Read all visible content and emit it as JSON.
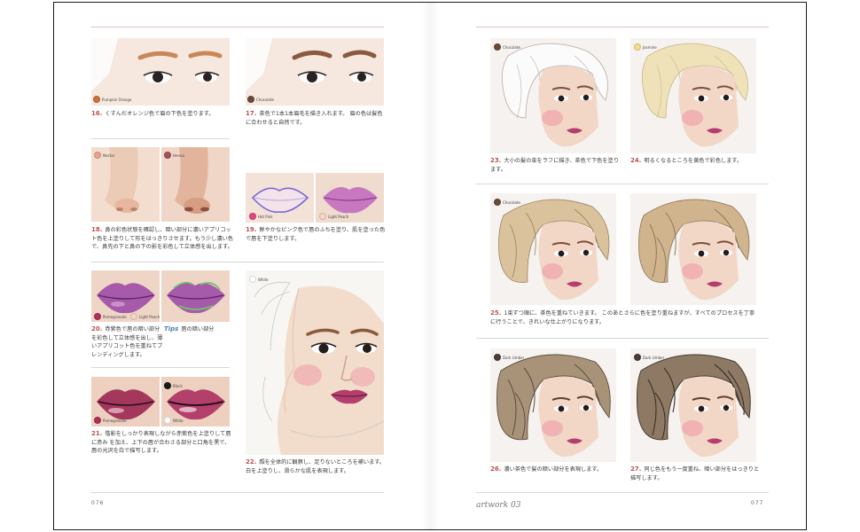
{
  "left_page": {
    "folio": "076",
    "steps": {
      "s16": {
        "num": "16.",
        "text": "くすんだオレンジ色で眉の下色を塗ります。",
        "swatches": [
          {
            "label": "Pumpkin Orange",
            "color": "#c8733a"
          }
        ]
      },
      "s17": {
        "num": "17.",
        "text": "茶色で1本1本眉毛を描き入れます。 眉の色は髪色に合わせると自然です。",
        "swatches": [
          {
            "label": "Chocolate",
            "color": "#6a4a3a"
          }
        ]
      },
      "s18": {
        "num": "18.",
        "text": "鼻の彩色状態を確認し、暗い部分に濃いアプリコット色を上塗りして形をはっきりさせます。もう少し濃い色で、鼻先の下と鼻の下の影を彩色して立体感を出します。",
        "swatches": [
          {
            "label": "Nectar",
            "color": "#e8a589"
          },
          {
            "label": "Henna",
            "color": "#a6505a"
          }
        ]
      },
      "s19": {
        "num": "19.",
        "text": "鮮やかなピンク色で唇のふちを塗り、肌を塗った色で唇を下塗りします。",
        "swatches": [
          {
            "label": "Hot Pink",
            "color": "#e0457f"
          },
          {
            "label": "Light Peach",
            "color": "#f4d6c4"
          }
        ]
      },
      "s20": {
        "num": "20.",
        "text": "赤紫色で唇の暗い部分を彩色して立体感を出し、薄いアプリコット色を重ねてブレンディングします。",
        "swatches": [
          {
            "label": "Pomegranate",
            "color": "#b0305c"
          },
          {
            "label": "Light Peach",
            "color": "#f4d6c4"
          }
        ]
      },
      "s21": {
        "num": "21.",
        "text": "階影をしっかり表現しながら赤紫色を上塗りして唇に赤み を加え、上下の唇が合わさる部分と口角を黒で、唇の光沢を白で描写します。",
        "swatches": [
          {
            "label": "Black",
            "color": "#1a1a1a"
          },
          {
            "label": "Pomegranate",
            "color": "#b0305c"
          },
          {
            "label": "White",
            "color": "#ffffff"
          }
        ]
      },
      "s22": {
        "num": "22.",
        "text": "顔を全体的に観察し、足りないところを補います。 白を上塗りし、滑らかな肌を表現します。",
        "swatches": [
          {
            "label": "White",
            "color": "#ffffff"
          }
        ]
      }
    },
    "tips": {
      "label": "Tips",
      "text": "唇の暗い部分"
    }
  },
  "right_page": {
    "folio": "077",
    "script_mark": "artwork 03",
    "steps": {
      "s23": {
        "num": "23.",
        "text": "大小の髪の束をラフに描き、茶色で下色を塗ります。",
        "swatches": [
          {
            "label": "Chocolate",
            "color": "#6a4a3a"
          }
        ]
      },
      "s24": {
        "num": "24.",
        "text": "明るくなるところを黄色で彩色します。",
        "swatches": [
          {
            "label": "Jasmine",
            "color": "#f3dc8c"
          }
        ]
      },
      "s25": {
        "num": "25.",
        "text": "1束ずつ順に、茶色を重ねていきます。 このあとさらに色を塗り重ねますが、すべてのプロセスを丁寧に行うことで、きれいな仕上がりになります。",
        "swatches": [
          {
            "label": "Chocolate",
            "color": "#6a4a3a"
          }
        ]
      },
      "s26": {
        "num": "26.",
        "text": "濃い茶色で髪の暗い部分を表現します。",
        "swatches": [
          {
            "label": "Dark Umber",
            "color": "#4a3b34"
          }
        ]
      },
      "s27": {
        "num": "27.",
        "text": "同じ色をもう一度重ね、暗い部分をはっきりと描写します。",
        "swatches": [
          {
            "label": "Dark Umber",
            "color": "#4a3b34"
          }
        ]
      }
    }
  }
}
